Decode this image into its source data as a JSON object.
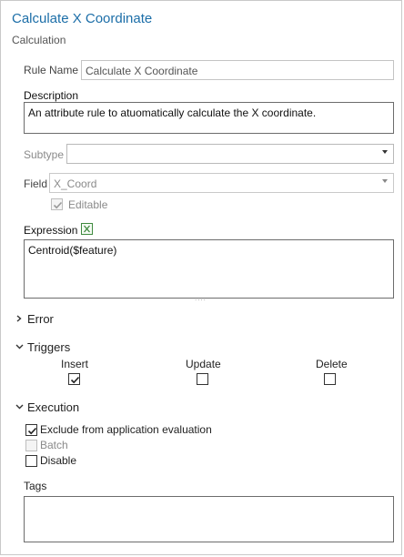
{
  "header": {
    "title": "Calculate X Coordinate",
    "subtitle": "Calculation"
  },
  "rule_name": {
    "label": "Rule Name",
    "value": "Calculate X Coordinate"
  },
  "description": {
    "label": "Description",
    "value": "An attribute rule to atuomatically calculate the X coordinate."
  },
  "subtype": {
    "label": "Subtype",
    "value": ""
  },
  "field": {
    "label": "Field",
    "value": "X_Coord",
    "editable_label": "Editable",
    "editable_checked": true
  },
  "expression": {
    "label": "Expression",
    "value": "Centroid($feature)",
    "grip": "....",
    "icon": "arcade-expression-icon"
  },
  "sections": {
    "error": "Error",
    "triggers": "Triggers",
    "execution": "Execution"
  },
  "triggers": [
    {
      "label": "Insert",
      "checked": true
    },
    {
      "label": "Update",
      "checked": false
    },
    {
      "label": "Delete",
      "checked": false
    }
  ],
  "execution": {
    "exclude_label": "Exclude from application evaluation",
    "exclude_checked": true,
    "batch_label": "Batch",
    "batch_checked": false,
    "batch_disabled": true,
    "disable_label": "Disable",
    "disable_checked": false
  },
  "tags": {
    "label": "Tags",
    "value": ""
  },
  "colors": {
    "title": "#1c6ea8",
    "expression_icon": "#3f8a3f"
  }
}
